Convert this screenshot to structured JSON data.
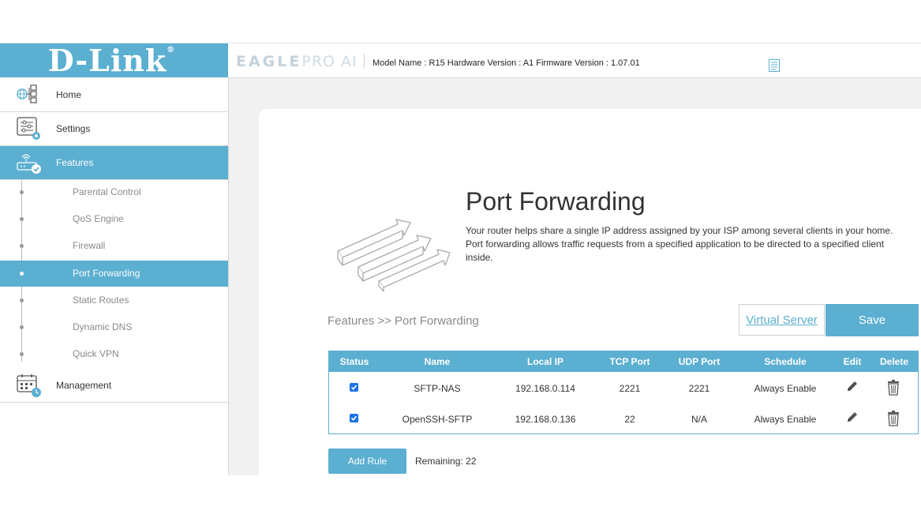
{
  "header": {
    "logo": "D-Link",
    "logo_mark": "®",
    "brand_bold": "EAGLE",
    "brand_light": "PRO AI",
    "model_info": "Model Name : R15 Hardware Version : A1 Firmware Version : 1.07.01"
  },
  "sidebar": {
    "main": [
      {
        "label": "Home",
        "icon": "globe-network-icon"
      },
      {
        "label": "Settings",
        "icon": "settings-sliders-icon"
      },
      {
        "label": "Features",
        "icon": "router-check-icon"
      },
      {
        "label": "Management",
        "icon": "calendar-clock-icon"
      }
    ],
    "sub": [
      {
        "label": "Parental Control"
      },
      {
        "label": "QoS Engine"
      },
      {
        "label": "Firewall"
      },
      {
        "label": "Port Forwarding"
      },
      {
        "label": "Static Routes"
      },
      {
        "label": "Dynamic DNS"
      },
      {
        "label": "Quick VPN"
      }
    ]
  },
  "main": {
    "title": "Port Forwarding",
    "description": "Your router helps share a single IP address assigned by your ISP among several clients in your home. Port forwarding allows traffic requests from a specified application to be directed to a specified client inside.",
    "breadcrumb": "Features >> Port Forwarding",
    "virtual_server_label": "Virtual Server",
    "save_label": "Save",
    "add_rule_label": "Add Rule",
    "remaining": "Remaining: 22"
  },
  "table": {
    "headers": [
      "Status",
      "Name",
      "Local IP",
      "TCP Port",
      "UDP Port",
      "Schedule",
      "Edit",
      "Delete"
    ],
    "rows": [
      {
        "status": true,
        "name": "SFTP-NAS",
        "local_ip": "192.168.0.114",
        "tcp": "2221",
        "udp": "2221",
        "schedule": "Always Enable"
      },
      {
        "status": true,
        "name": "OpenSSH-SFTP",
        "local_ip": "192.168.0.136",
        "tcp": "22",
        "udp": "N/A",
        "schedule": "Always Enable"
      }
    ]
  },
  "colors": {
    "accent": "#5bafd1",
    "checkbox": "#1a73e8"
  }
}
